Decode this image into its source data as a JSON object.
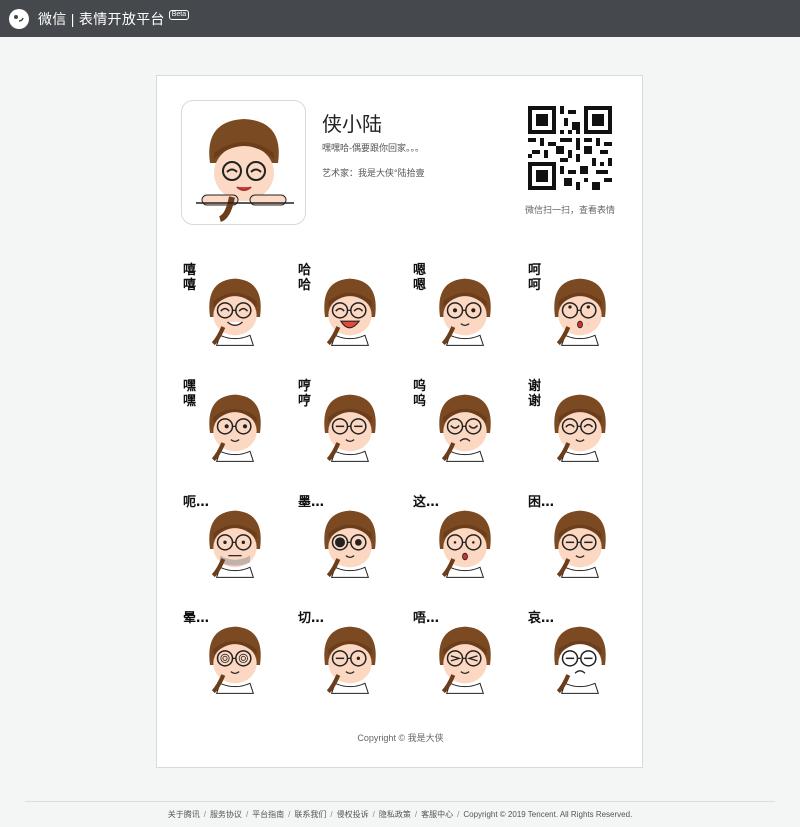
{
  "header": {
    "brand": "微信 | 表情开放平台",
    "badge": "Beta",
    "logo_icon": "wechat-sticker-logo"
  },
  "pack": {
    "title": "侠小陆",
    "description": "嘿嘿哈-偶要跟你回家。。。",
    "artist": "艺术家：我是大侠°陆拾壹",
    "qr_caption": "微信扫一扫，查看表情",
    "copyright": "Copyright © 我是大侠"
  },
  "stickers": [
    {
      "caption": "嘻嘻",
      "expr": "grin"
    },
    {
      "caption": "哈哈",
      "expr": "laugh"
    },
    {
      "caption": "嗯嗯",
      "expr": "smile"
    },
    {
      "caption": "呵呵",
      "expr": "eyeroll"
    },
    {
      "caption": "嘿嘿",
      "expr": "smirk"
    },
    {
      "caption": "哼哼",
      "expr": "meh"
    },
    {
      "caption": "呜呜",
      "expr": "cry"
    },
    {
      "caption": "谢谢",
      "expr": "thanks"
    },
    {
      "caption": "呃…",
      "expr": "awkward"
    },
    {
      "caption": "墨…",
      "expr": "blank"
    },
    {
      "caption": "这…",
      "expr": "shock"
    },
    {
      "caption": "困…",
      "expr": "sleepy"
    },
    {
      "caption": "晕…",
      "expr": "dizzy"
    },
    {
      "caption": "切…",
      "expr": "pout"
    },
    {
      "caption": "唔…",
      "expr": "squint"
    },
    {
      "caption": "哀…",
      "expr": "despair"
    }
  ],
  "footer": {
    "links": [
      "关于腾讯",
      "服务协议",
      "平台指南",
      "联系我们",
      "侵权投诉",
      "隐私政策",
      "客服中心"
    ],
    "copyright": "Copyright © 2019 Tencent. All Rights Reserved."
  }
}
